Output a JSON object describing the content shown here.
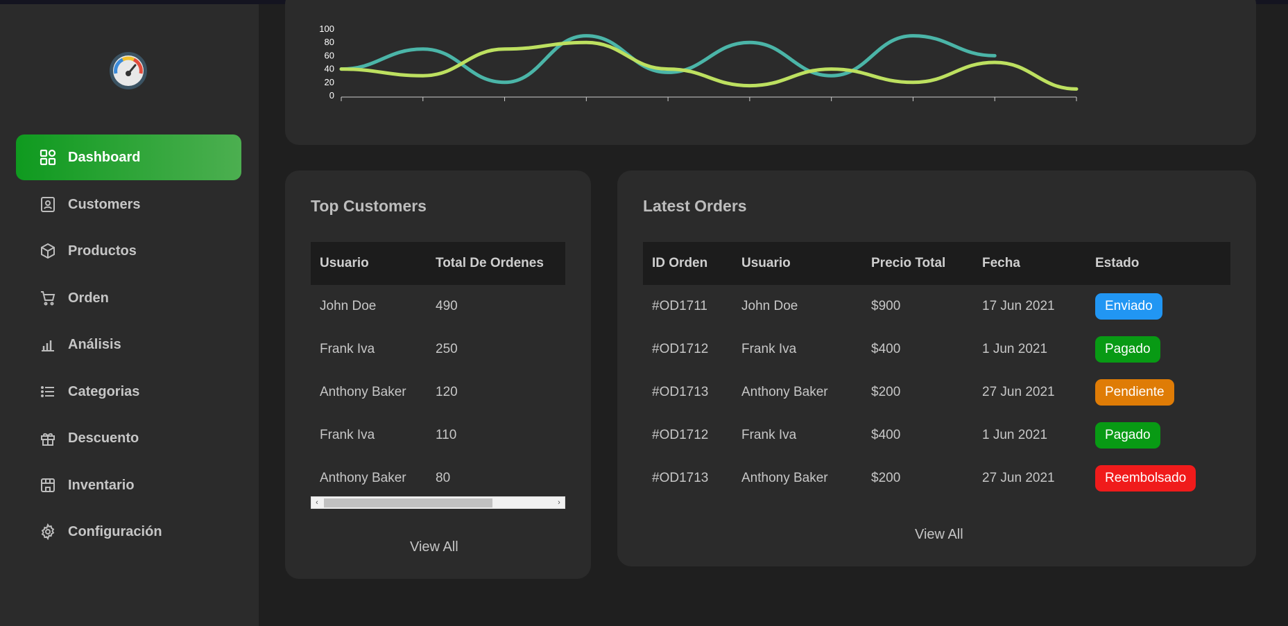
{
  "sidebar": {
    "logo_icon": "speedometer-icon",
    "items": [
      {
        "label": "Dashboard",
        "icon": "dashboard-grid-icon",
        "active": true
      },
      {
        "label": "Customers",
        "icon": "contact-card-icon",
        "active": false
      },
      {
        "label": "Productos",
        "icon": "box-icon",
        "active": false
      },
      {
        "label": "Orden",
        "icon": "cart-icon",
        "active": false
      },
      {
        "label": "Análisis",
        "icon": "bar-chart-icon",
        "active": false
      },
      {
        "label": "Categorias",
        "icon": "list-icon",
        "active": false
      },
      {
        "label": "Descuento",
        "icon": "gift-icon",
        "active": false
      },
      {
        "label": "Inventario",
        "icon": "store-icon",
        "active": false
      },
      {
        "label": "Configuración",
        "icon": "gear-icon",
        "active": false
      }
    ]
  },
  "chart_data": {
    "type": "line",
    "title": "",
    "xlabel": "",
    "ylabel": "",
    "ylim": [
      0,
      100
    ],
    "y_ticks": [
      "0",
      "20",
      "40",
      "60",
      "80",
      "100"
    ],
    "x": [
      0,
      1,
      2,
      3,
      4,
      5,
      6,
      7,
      8,
      9
    ],
    "colors": [
      "#4bb5a8",
      "#bde060"
    ],
    "series": [
      {
        "values": [
          40,
          70,
          20,
          90,
          35,
          80,
          30,
          90,
          60
        ]
      },
      {
        "values": [
          40,
          30,
          70,
          80,
          40,
          15,
          40,
          20,
          50,
          10
        ]
      }
    ]
  },
  "top_customers": {
    "title": "Top Customers",
    "headers": [
      "Usuario",
      "Total De Ordenes"
    ],
    "rows": [
      [
        "John Doe",
        "490"
      ],
      [
        "Frank Iva",
        "250"
      ],
      [
        "Anthony Baker",
        "120"
      ],
      [
        "Frank Iva",
        "110"
      ],
      [
        "Anthony Baker",
        "80"
      ]
    ],
    "scroll_left": "‹",
    "scroll_right": "›",
    "view_all": "View All"
  },
  "latest_orders": {
    "title": "Latest Orders",
    "headers": [
      "ID Orden",
      "Usuario",
      "Precio Total",
      "Fecha",
      "Estado"
    ],
    "rows": [
      {
        "id": "#OD1711",
        "user": "John Doe",
        "price": "$900",
        "date": "17 Jun 2021",
        "status": "Enviado",
        "color": "#2196f3"
      },
      {
        "id": "#OD1712",
        "user": "Frank Iva",
        "price": "$400",
        "date": "1 Jun 2021",
        "status": "Pagado",
        "color": "#089a14"
      },
      {
        "id": "#OD1713",
        "user": "Anthony Baker",
        "price": "$200",
        "date": "27 Jun 2021",
        "status": "Pendiente",
        "color": "#df7c06"
      },
      {
        "id": "#OD1712",
        "user": "Frank Iva",
        "price": "$400",
        "date": "1 Jun 2021",
        "status": "Pagado",
        "color": "#089a14"
      },
      {
        "id": "#OD1713",
        "user": "Anthony Baker",
        "price": "$200",
        "date": "27 Jun 2021",
        "status": "Reembolsado",
        "color": "#f01b1b"
      }
    ],
    "view_all": "View All"
  }
}
